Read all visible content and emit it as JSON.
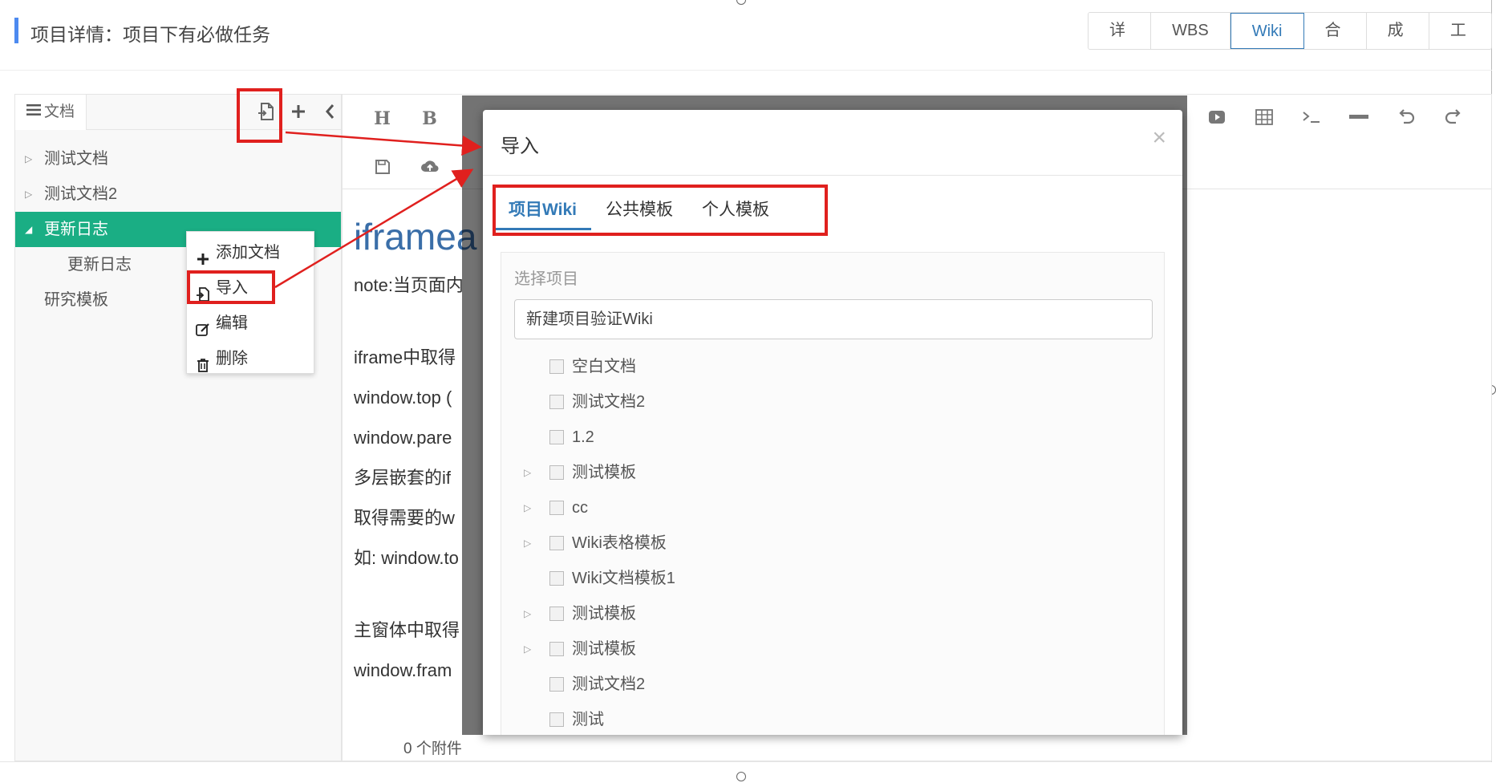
{
  "header": {
    "title": "项目详情：项目下有必做任务",
    "tabs": [
      {
        "label": "详情",
        "active": false
      },
      {
        "label": "WBS",
        "active": false
      },
      {
        "label": "Wiki",
        "active": true
      },
      {
        "label": "合同",
        "active": false
      },
      {
        "label": "成本",
        "active": false
      },
      {
        "label": "工时",
        "active": false
      }
    ]
  },
  "sidebar": {
    "tab_label": "文档",
    "tree": [
      {
        "label": "测试文档",
        "caret": "▷"
      },
      {
        "label": "测试文档2",
        "caret": "▷"
      },
      {
        "label": "更新日志",
        "caret": "◢"
      },
      {
        "label": "更新日志",
        "caret": ""
      },
      {
        "label": "研究模板",
        "caret": ""
      }
    ]
  },
  "context_menu": {
    "items": [
      "添加文档",
      "导入",
      "编辑",
      "删除"
    ]
  },
  "editor": {
    "heading": "iframe",
    "heading_tail": "a",
    "lines": [
      "note:当页面内",
      "iframe中取得",
      "window.top (",
      "window.pare",
      "多层嵌套的if",
      "取得需要的w",
      "如: window.to",
      "主窗体中取得",
      "window.fram"
    ],
    "attachments": "0 个附件"
  },
  "modal": {
    "title": "导入",
    "close": "×",
    "tabs": [
      {
        "label": "项目Wiki",
        "active": true
      },
      {
        "label": "公共模板",
        "active": false
      },
      {
        "label": "个人模板",
        "active": false
      }
    ],
    "select_label": "选择项目",
    "select_value": "新建项目验证Wiki",
    "items": [
      {
        "label": "空白文档",
        "caret": ""
      },
      {
        "label": "测试文档2",
        "caret": ""
      },
      {
        "label": "1.2",
        "caret": ""
      },
      {
        "label": "测试模板",
        "caret": "▷"
      },
      {
        "label": "cc",
        "caret": "▷"
      },
      {
        "label": "Wiki表格模板",
        "caret": "▷"
      },
      {
        "label": "Wiki文档模板1",
        "caret": ""
      },
      {
        "label": "测试模板",
        "caret": "▷"
      },
      {
        "label": "测试模板",
        "caret": "▷"
      },
      {
        "label": "测试文档2",
        "caret": ""
      },
      {
        "label": "测试",
        "caret": ""
      }
    ]
  },
  "colors": {
    "accent": "#337ab7",
    "tree_active": "#1aae84",
    "annotation": "#e0201e",
    "title_bar": "#4d8af0"
  }
}
